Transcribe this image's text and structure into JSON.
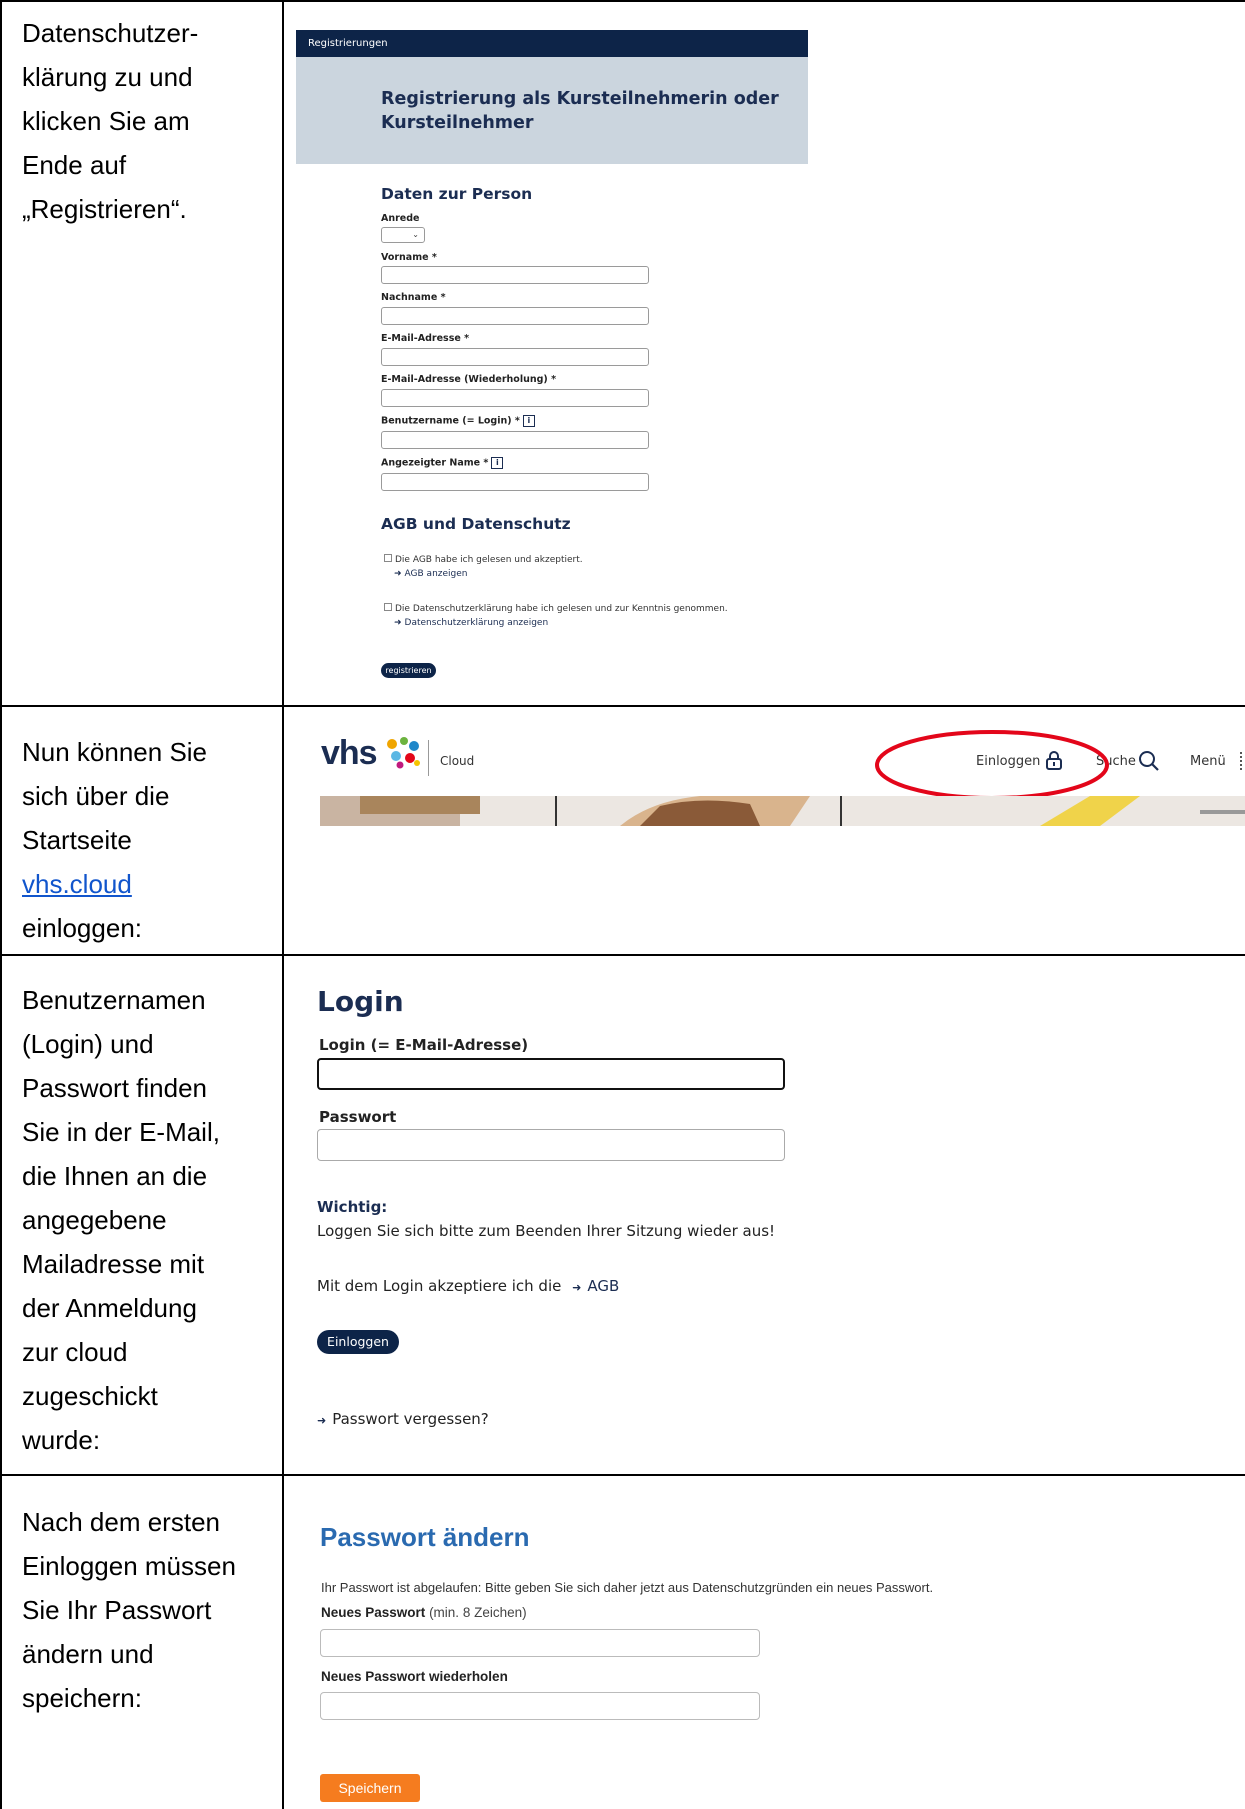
{
  "rows": [
    {
      "instruction": [
        "Datenschutzer-",
        "klärung zu und",
        "klicken Sie am",
        "Ende auf",
        "„Registrieren“."
      ]
    },
    {
      "instruction_before": [
        "Nun können Sie",
        "sich über die",
        "Startseite"
      ],
      "link": "vhs.cloud",
      "instruction_after": [
        "einloggen:"
      ]
    },
    {
      "instruction": [
        "Benutzernamen",
        "(Login) und",
        "Passwort finden",
        "Sie in der E-Mail,",
        "die Ihnen an die",
        "angegebene",
        "Mailadresse mit",
        "der Anmeldung",
        "zur cloud",
        "zugeschickt",
        "wurde:"
      ]
    },
    {
      "instruction": [
        "Nach dem ersten",
        "Einloggen müssen",
        "Sie Ihr Passwort",
        "ändern und",
        "speichern:"
      ]
    }
  ],
  "registration": {
    "bar_label": "Registrierungen",
    "title": "Registrierung als Kursteilnehmerin oder Kursteilnehmer",
    "section_person": "Daten zur Person",
    "anrede": "Anrede",
    "vorname": "Vorname *",
    "nachname": "Nachname *",
    "email": "E-Mail-Adresse *",
    "email_repeat": "E-Mail-Adresse (Wiederholung) *",
    "username": "Benutzername (= Login) *",
    "display_name": "Angezeigter Name *",
    "section_agb": "AGB und Datenschutz",
    "agb_check": "Die AGB habe ich gelesen und akzeptiert.",
    "agb_link": "AGB anzeigen",
    "privacy_check": "Die Datenschutzerklärung habe ich gelesen und zur Kenntnis genommen.",
    "privacy_link": "Datenschutzerklärung anzeigen",
    "submit": "registrieren"
  },
  "vhs_header": {
    "logo": "vhs",
    "product": "Cloud",
    "login": "Einloggen",
    "search": "Suche",
    "menu": "Menü"
  },
  "login": {
    "title": "Login",
    "login_label": "Login (= E-Mail-Adresse)",
    "password_label": "Passwort",
    "important_heading": "Wichtig:",
    "important_text": "Loggen Sie sich bitte zum Beenden Ihrer Sitzung wieder aus!",
    "agb_text": "Mit dem Login akzeptiere ich die",
    "agb_link": "AGB",
    "button": "Einloggen",
    "forgot": "Passwort vergessen?"
  },
  "password_change": {
    "title": "Passwort ändern",
    "notice": "Ihr Passwort ist abgelaufen: Bitte geben Sie sich daher jetzt aus Datenschutzgründen ein neues Passwort.",
    "new_label": "Neues Passwort",
    "new_hint": "(min. 8 Zeichen)",
    "repeat_label": "Neues Passwort wiederholen",
    "save": "Speichern"
  },
  "colors": {
    "navy": "#0d2448",
    "header_bg": "#cbd5de",
    "link_blue": "#1155cc",
    "annotation_red": "#e3061a",
    "pw_title": "#2a6ab0",
    "save_orange": "#f57c1f"
  }
}
